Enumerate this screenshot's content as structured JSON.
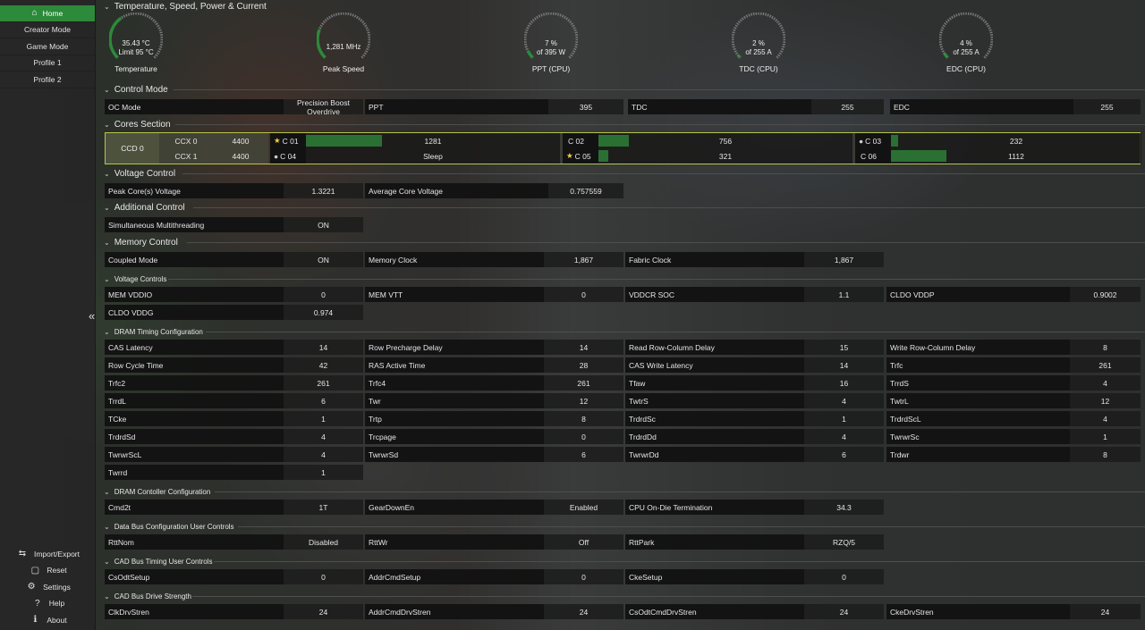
{
  "nav": {
    "home": "Home",
    "items": [
      "Creator Mode",
      "Game Mode",
      "Profile 1",
      "Profile 2"
    ],
    "bottom": [
      {
        "icon": "import-export-icon",
        "label": "Import/Export"
      },
      {
        "icon": "reset-icon",
        "label": "Reset"
      },
      {
        "icon": "settings-icon",
        "label": "Settings"
      },
      {
        "icon": "help-icon",
        "label": "Help"
      },
      {
        "icon": "info-icon",
        "label": "About"
      }
    ]
  },
  "sections": {
    "temp": "Temperature, Speed, Power & Current",
    "control": "Control Mode",
    "cores": "Cores Section",
    "voltage": "Voltage Control",
    "additional": "Additional Control",
    "memory": "Memory Control",
    "volt_ctrl": "Voltage Controls",
    "dram_timing": "DRAM Timing Configuration",
    "dram_ctrl": "DRAM Contoller Configuration",
    "databus": "Data Bus Configuration User Controls",
    "cadtiming": "CAD Bus Timing User Controls",
    "caddrive": "CAD Bus Drive Strength"
  },
  "gauges": [
    {
      "l1": "35.43 °C",
      "l2": "Limit 95 °C",
      "label": "Temperature",
      "fraction": 0.37
    },
    {
      "l1": "1,281  MHz",
      "l2": "",
      "label": "Peak Speed",
      "fraction": 0.25
    },
    {
      "l1": "7 %",
      "l2": "of 395 W",
      "label": "PPT (CPU)",
      "fraction": 0.07
    },
    {
      "l1": "2 %",
      "l2": "of 255 A",
      "label": "TDC (CPU)",
      "fraction": 0.02
    },
    {
      "l1": "4 %",
      "l2": "of 255 A",
      "label": "EDC (CPU)",
      "fraction": 0.04
    }
  ],
  "control": {
    "oc_label": "OC Mode",
    "oc_value": "Precision Boost Overdrive",
    "ppt": "PPT",
    "ppt_v": "395",
    "tdc": "TDC",
    "tdc_v": "255",
    "edc": "EDC",
    "edc_v": "255"
  },
  "cores": {
    "ccd": "CCD 0",
    "ccx0": "CCX 0",
    "ccx0_f": "4400",
    "ccx1": "CCX 1",
    "ccx1_f": "4400",
    "list": [
      {
        "name": "C 01",
        "mark": "★",
        "value": "1281",
        "fraction": 0.3
      },
      {
        "name": "C 02",
        "mark": "",
        "value": "756",
        "fraction": 0.12
      },
      {
        "name": "C 03",
        "mark": "●",
        "value": "232",
        "fraction": 0.03
      },
      {
        "name": "C 04",
        "mark": "●",
        "value": "Sleep",
        "fraction": 0
      },
      {
        "name": "C 05",
        "mark": "★",
        "value": "321",
        "fraction": 0.04
      },
      {
        "name": "C 06",
        "mark": "",
        "value": "1112",
        "fraction": 0.22
      }
    ]
  },
  "voltage": {
    "peak": "Peak Core(s) Voltage",
    "peak_v": "1.3221",
    "avg": "Average Core Voltage",
    "avg_v": "0.757559"
  },
  "additional": {
    "smt": "Simultaneous Multithreading",
    "smt_v": "ON"
  },
  "memory": {
    "coupled": "Coupled Mode",
    "coupled_v": "ON",
    "memclk": "Memory Clock",
    "memclk_v": "1,867",
    "fclk": "Fabric Clock",
    "fclk_v": "1,867"
  },
  "volt_ctrl": [
    [
      "MEM VDDIO",
      "0"
    ],
    [
      "MEM VTT",
      "0"
    ],
    [
      "VDDCR SOC",
      "1.1"
    ],
    [
      "CLDO VDDP",
      "0.9002"
    ],
    [
      "CLDO VDDG",
      "0.974"
    ]
  ],
  "dram": [
    [
      "CAS Latency",
      "14"
    ],
    [
      "Row Precharge Delay",
      "14"
    ],
    [
      "Read Row-Column Delay",
      "15"
    ],
    [
      "Write Row-Column Delay",
      "8"
    ],
    [
      "Row Cycle Time",
      "42"
    ],
    [
      "RAS Active Time",
      "28"
    ],
    [
      "CAS Write Latency",
      "14"
    ],
    [
      "Trfc",
      "261"
    ],
    [
      "Trfc2",
      "261"
    ],
    [
      "Trfc4",
      "261"
    ],
    [
      "Tfaw",
      "16"
    ],
    [
      "TrrdS",
      "4"
    ],
    [
      "TrrdL",
      "6"
    ],
    [
      "Twr",
      "12"
    ],
    [
      "TwtrS",
      "4"
    ],
    [
      "TwtrL",
      "12"
    ],
    [
      "TCke",
      "1"
    ],
    [
      "Trtp",
      "8"
    ],
    [
      "TrdrdSc",
      "1"
    ],
    [
      "TrdrdScL",
      "4"
    ],
    [
      "TrdrdSd",
      "4"
    ],
    [
      "Trcpage",
      "0"
    ],
    [
      "TrdrdDd",
      "4"
    ],
    [
      "TwrwrSc",
      "1"
    ],
    [
      "TwrwrScL",
      "4"
    ],
    [
      "TwrwrSd",
      "6"
    ],
    [
      "TwrwrDd",
      "6"
    ],
    [
      "Trdwr",
      "8"
    ],
    [
      "Twrrd",
      "1"
    ]
  ],
  "dram_ctrl": [
    [
      "Cmd2t",
      "1T"
    ],
    [
      "GearDownEn",
      "Enabled"
    ],
    [
      "CPU On-Die Termination",
      "34.3"
    ]
  ],
  "databus": [
    [
      "RttNom",
      "Disabled"
    ],
    [
      "RttWr",
      "Off"
    ],
    [
      "RttPark",
      "RZQ/5"
    ]
  ],
  "cadtiming": [
    [
      "CsOdtSetup",
      "0"
    ],
    [
      "AddrCmdSetup",
      "0"
    ],
    [
      "CkeSetup",
      "0"
    ]
  ],
  "caddrive": [
    [
      "ClkDrvStren",
      "24"
    ],
    [
      "AddrCmdDrvStren",
      "24"
    ],
    [
      "CsOdtCmdDrvStren",
      "24"
    ],
    [
      "CkeDrvStren",
      "24"
    ]
  ],
  "colors": {
    "accent": "#2c8a3a",
    "core_border": "#b5c64a"
  }
}
